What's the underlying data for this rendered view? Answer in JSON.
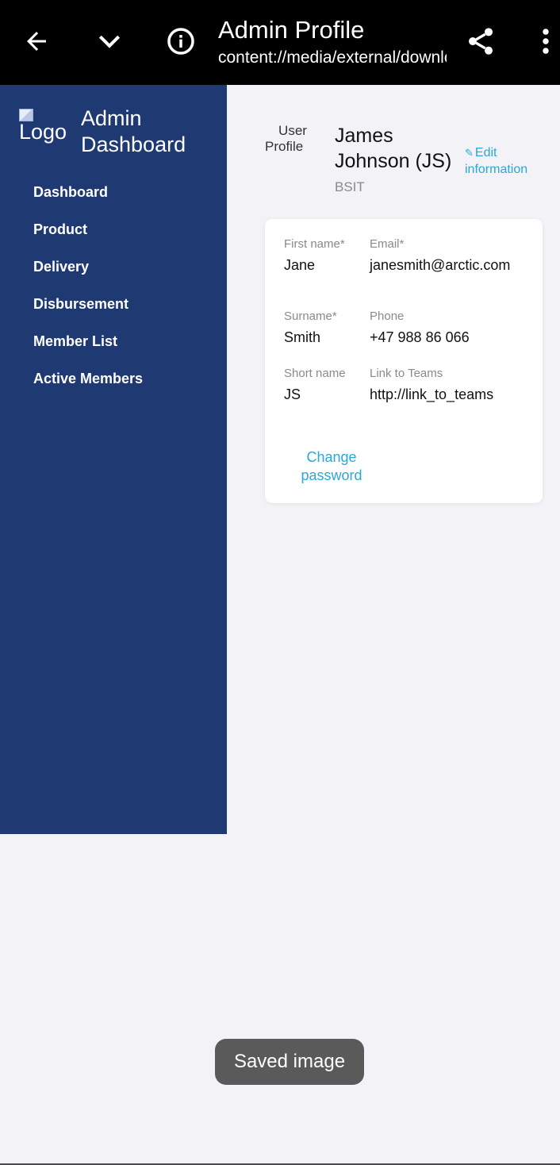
{
  "topbar": {
    "title": "Admin Profile",
    "url": "content://media/external/downloads",
    "icons": [
      "back-arrow-icon",
      "chevron-down-icon",
      "info-icon",
      "share-icon",
      "more-vert-icon"
    ]
  },
  "sidebar": {
    "logo_alt": "Logo",
    "title": "Admin Dashboard",
    "items": [
      {
        "label": "Dashboard"
      },
      {
        "label": "Product"
      },
      {
        "label": "Delivery"
      },
      {
        "label": "Disbursement"
      },
      {
        "label": "Member List"
      },
      {
        "label": "Active Members"
      }
    ]
  },
  "profile": {
    "avatar_alt_line1": "User",
    "avatar_alt_line2": "Profile",
    "name": "James Johnson (JS)",
    "role": "BSIT",
    "edit_label": "Edit information"
  },
  "card": {
    "first_name": {
      "label": "First name*",
      "value": "Jane"
    },
    "email": {
      "label": "Email*",
      "value": "janesmith@arctic.com"
    },
    "surname": {
      "label": "Surname*",
      "value": "Smith"
    },
    "phone": {
      "label": "Phone",
      "value": "+47 988 86 066"
    },
    "short_name": {
      "label": "Short name",
      "value": "JS"
    },
    "teams_link": {
      "label": "Link to Teams",
      "value": "http://link_to_teams"
    },
    "change_password_label": "Change password"
  },
  "toast": {
    "message": "Saved image"
  },
  "colors": {
    "sidebar_bg": "#1f3a73",
    "link_accent": "#2aa8d8",
    "page_bg": "#f2f2f7",
    "topbar_bg": "#000000"
  }
}
